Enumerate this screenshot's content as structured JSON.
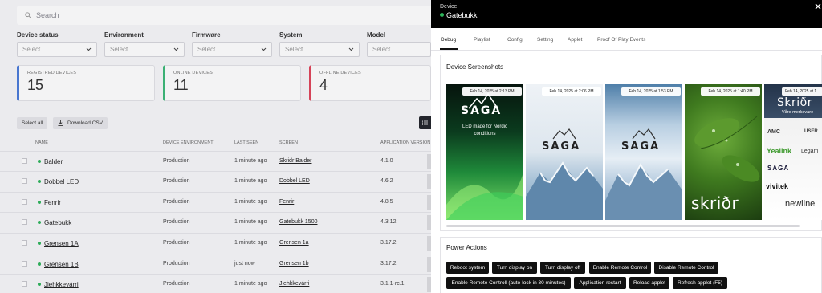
{
  "search": {
    "placeholder": "Search"
  },
  "filters": [
    {
      "label": "Device status",
      "value": "Select"
    },
    {
      "label": "Environment",
      "value": "Select"
    },
    {
      "label": "Firmware",
      "value": "Select"
    },
    {
      "label": "System",
      "value": "Select"
    },
    {
      "label": "Model",
      "value": "Select"
    }
  ],
  "stats": [
    {
      "label": "REGISTRED DEVICES",
      "value": "15",
      "color": "#4a7bd9"
    },
    {
      "label": "ONLINE DEVICES",
      "value": "11",
      "color": "#3cb878"
    },
    {
      "label": "OFFLINE DEVICES",
      "value": "4",
      "color": "#e0455a"
    }
  ],
  "toolbar": {
    "select_all": "Select all",
    "download_csv": "Download CSV"
  },
  "table": {
    "headers": [
      "NAME",
      "DEVICE ENVIRONMENT",
      "LAST SEEN",
      "SCREEN",
      "APPLICATION VERSION"
    ],
    "rows": [
      {
        "name": "Balder",
        "env": "Production",
        "seen": "1 minute ago",
        "screen": "Skridr Balder",
        "version": "4.1.0"
      },
      {
        "name": "Dobbel LED",
        "env": "Production",
        "seen": "1 minute ago",
        "screen": "Dobbel LED",
        "version": "4.6.2"
      },
      {
        "name": "Fenrir",
        "env": "Production",
        "seen": "1 minute ago",
        "screen": "Fenrir",
        "version": "4.8.5"
      },
      {
        "name": "Gatebukk",
        "env": "Production",
        "seen": "1 minute ago",
        "screen": "Gatebukk 1500",
        "version": "4.3.12"
      },
      {
        "name": "Grensen 1A",
        "env": "Production",
        "seen": "1 minute ago",
        "screen": "Grensen 1a",
        "version": "3.17.2"
      },
      {
        "name": "Grensen 1B",
        "env": "Production",
        "seen": "just now",
        "screen": "Grensen 1b",
        "version": "3.17.2"
      },
      {
        "name": "Jiehkkevárri",
        "env": "Production",
        "seen": "1 minute ago",
        "screen": "Jiehkkevárri",
        "version": "3.1.1-rc.1"
      }
    ]
  },
  "drawer": {
    "label": "Device",
    "title": "Gatebukk",
    "status_color": "#2db45a",
    "tabs": [
      "Debug",
      "Playlist",
      "Config",
      "Setting",
      "Applet",
      "Proof Of Play Events"
    ],
    "active_tab": "Debug",
    "screenshots_title": "Device Screenshots",
    "screenshots": [
      {
        "timestamp": "Feb 14, 2025 at 2:13 PM",
        "logo": "SAGA",
        "caption": "LED made for Nordic conditions"
      },
      {
        "timestamp": "Feb 14, 2025 at 2:06 PM",
        "logo": "SAGA"
      },
      {
        "timestamp": "Feb 14, 2025 at 1:53 PM",
        "logo": "SAGA"
      },
      {
        "timestamp": "Feb 14, 2025 at 1:40 PM",
        "logo": "skriðr"
      },
      {
        "timestamp": "Feb 14, 2025 at 1",
        "logo": "Skriðr",
        "tagline": "Våre merkevare",
        "brands": [
          "AMC",
          "USER",
          "Yealink",
          "Legam",
          "SAGA",
          "vivitek",
          "newline"
        ]
      }
    ],
    "power_title": "Power Actions",
    "power_actions": [
      "Reboot system",
      "Turn display on",
      "Turn display off",
      "Enable Remote Control",
      "Disable Remote Control",
      "Enable Remote Controll (auto-lock in 30 minutes)",
      "Application restart",
      "Reload applet",
      "Refresh applet (F5)"
    ]
  }
}
